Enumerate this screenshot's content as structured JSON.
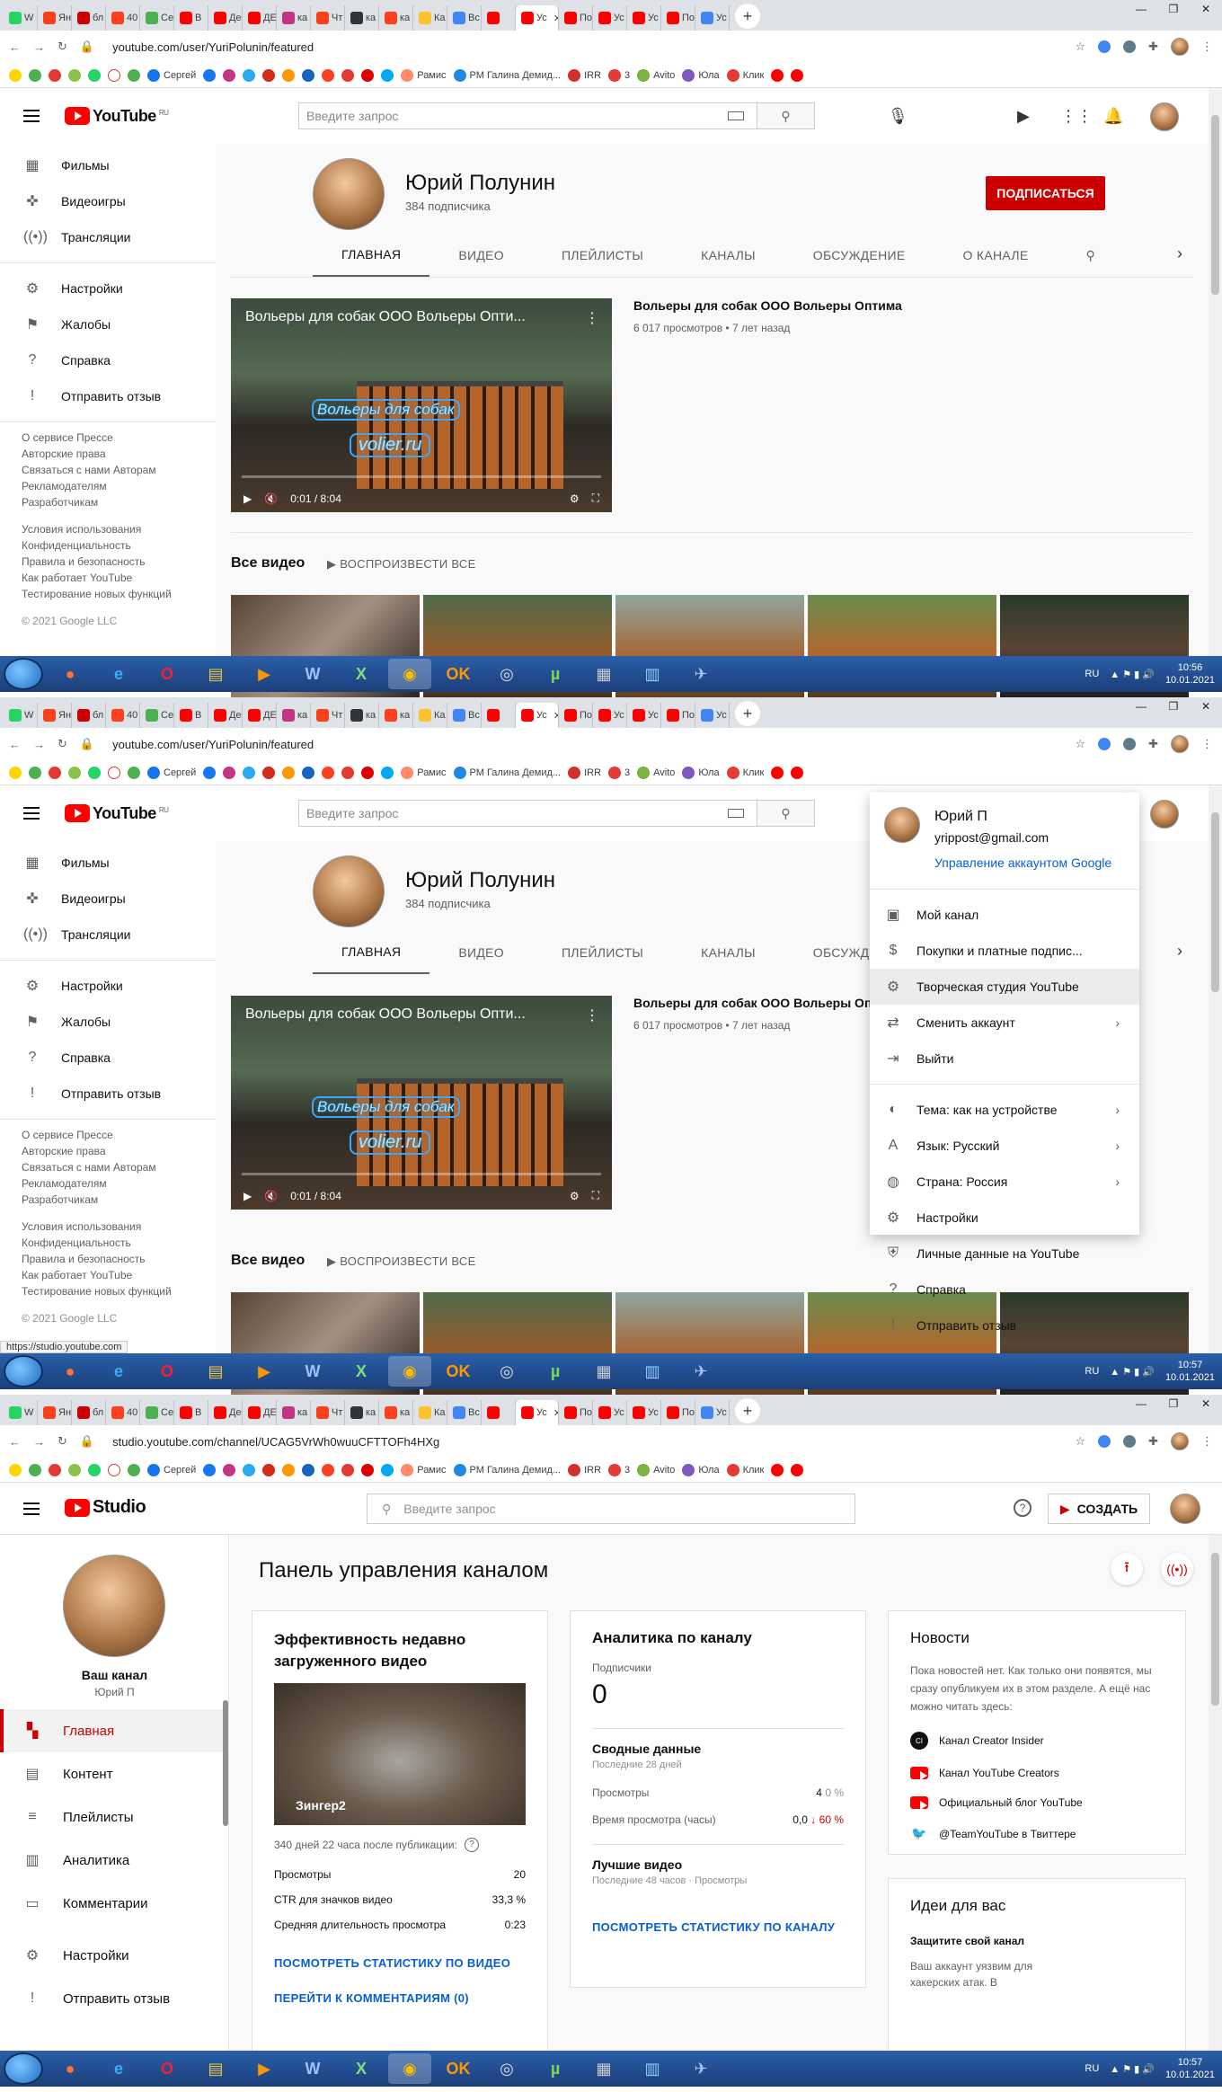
{
  "browser": {
    "tabs": [
      "W",
      "Яндекс",
      "бл",
      "40",
      "Се",
      "В",
      "Де",
      "ДЕ",
      "ка",
      "Чт",
      "ка",
      "ка",
      "Ка",
      "Вс",
      "",
      "Ус",
      "По",
      "Ус",
      "Ус",
      "По",
      "Ус"
    ],
    "bookmarks": [
      "Сергей",
      "Рамис",
      "РМ Галина Демид...",
      "IRR",
      "3",
      "Avito",
      "Юла",
      "Клик"
    ]
  },
  "screen1": {
    "url": "youtube.com/user/YuriPolunin/featured"
  },
  "screen2": {
    "url": "youtube.com/user/YuriPolunin/featured",
    "status_url": "https://studio.youtube.com"
  },
  "screen3": {
    "url": "studio.youtube.com/channel/UCAG5VrWh0wuuCFTTOFh4HXg"
  },
  "youtube": {
    "logo_region": "RU",
    "search_placeholder": "Введите запрос",
    "sidebar": [
      "Фильмы",
      "Видеоигры",
      "Трансляции",
      "Настройки",
      "Жалобы",
      "Справка",
      "Отправить отзыв"
    ],
    "footer_links1": [
      "О сервисе",
      "Прессе",
      "Авторские права",
      "Связаться с нами",
      "Авторам",
      "Рекламодателям",
      "Разработчикам"
    ],
    "footer_links2": [
      "Условия использования",
      "Конфиденциальность",
      "Правила и безопасность",
      "Как работает YouTube",
      "Тестирование новых функций"
    ],
    "copyright": "© 2021 Google LLC",
    "channel_name": "Юрий Полунин",
    "subscribers": "384 подписчика",
    "subscribe_label": "ПОДПИСАТЬСЯ",
    "tabs": [
      "ГЛАВНАЯ",
      "ВИДЕО",
      "ПЛЕЙЛИСТЫ",
      "КАНАЛЫ",
      "ОБСУЖДЕНИЕ",
      "О КАНАЛЕ"
    ],
    "video_title_overlay": "Вольеры для собак ООО Вольеры Опти...",
    "watermark1": "Вольеры для собак",
    "watermark2": "volier.ru",
    "video_time": "0:01 / 8:04",
    "video_title": "Вольеры для собак ООО Вольеры Оптима",
    "video_meta": "6 017 просмотров • 7 лет назад",
    "all_videos": "Все видео",
    "play_all": "ВОСПРОИЗВЕСТИ ВСЕ"
  },
  "account_menu": {
    "name": "Юрий П",
    "email": "yrippost@gmail.com",
    "manage": "Управление аккаунтом Google",
    "items": [
      "Мой канал",
      "Покупки и платные подпис...",
      "Творческая студия YouTube",
      "Сменить аккаунт",
      "Выйти"
    ],
    "items2": [
      "Тема: как на устройстве",
      "Язык: Русский",
      "Страна: Россия",
      "Настройки",
      "Личные данные на YouTube",
      "Справка",
      "Отправить отзыв"
    ]
  },
  "studio": {
    "logo_text": "Studio",
    "search_placeholder": "Введите запрос",
    "create_label": "СОЗДАТЬ",
    "your_channel": "Ваш канал",
    "owner": "Юрий П",
    "nav": [
      "Главная",
      "Контент",
      "Плейлисты",
      "Аналитика",
      "Комментарии",
      "Настройки",
      "Отправить отзыв"
    ],
    "title": "Панель управления каналом",
    "perf": {
      "title": "Эффективность недавно загруженного видео",
      "thumb_title": "Зингер2",
      "since": "340 дней 22 часа после публикации:",
      "rows": [
        {
          "k": "Просмотры",
          "v": "20"
        },
        {
          "k": "CTR для значков видео",
          "v": "33,3 %"
        },
        {
          "k": "Средняя длительность просмотра",
          "v": "0:23"
        }
      ],
      "link1": "ПОСМОТРЕТЬ СТАТИСТИКУ ПО ВИДЕО",
      "link2": "ПЕРЕЙТИ К КОММЕНТАРИЯМ (0)"
    },
    "analytics": {
      "title": "Аналитика по каналу",
      "subs_label": "Подписчики",
      "subs_value": "0",
      "summary": "Сводные данные",
      "summary_period": "Последние 28 дней",
      "views_label": "Просмотры",
      "views_value": "4",
      "views_delta": "0 %",
      "watch_label": "Время просмотра (часы)",
      "watch_value": "0,0",
      "watch_delta": "60 %",
      "top": "Лучшие видео",
      "top_period": "Последние 48 часов · Просмотры",
      "link": "ПОСМОТРЕТЬ СТАТИСТИКУ ПО КАНАЛУ"
    },
    "news": {
      "title": "Новости",
      "text": "Пока новостей нет. Как только они появятся, мы сразу опубликуем их в этом разделе. А ещё нас можно читать здесь:",
      "items": [
        "Канал Creator Insider",
        "Канал YouTube Creators",
        "Официальный блог YouTube",
        "@TeamYouTube в Твиттере"
      ]
    },
    "ideas": {
      "title": "Идеи для вас",
      "sub": "Защитите свой канал",
      "text": "Ваш аккаунт уязвим для хакерских атак. В"
    }
  },
  "taskbar": [
    {
      "lang": "RU",
      "time": "10:56",
      "date": "10.01.2021"
    },
    {
      "lang": "RU",
      "time": "10:57",
      "date": "10.01.2021"
    },
    {
      "lang": "RU",
      "time": "10:57",
      "date": "10.01.2021"
    }
  ]
}
